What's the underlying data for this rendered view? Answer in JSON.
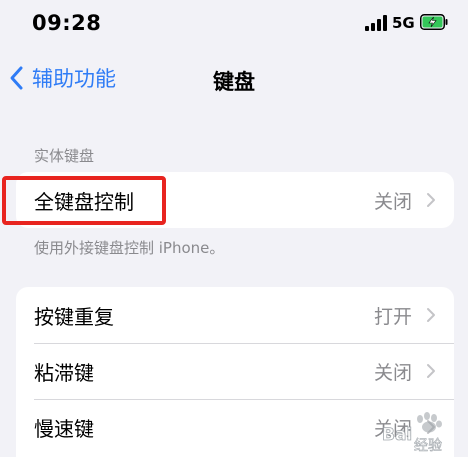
{
  "status_bar": {
    "time": "09:28",
    "network": "5G",
    "battery_color": "#34c759"
  },
  "nav": {
    "back_label": "辅助功能",
    "title": "键盘",
    "accent": "#2f7cf6"
  },
  "physical_keyboard": {
    "header": "实体键盘",
    "items": [
      {
        "label": "全键盘控制",
        "value": "关闭"
      }
    ],
    "footer": "使用外接键盘控制 iPhone。"
  },
  "key_settings": {
    "items": [
      {
        "label": "按键重复",
        "value": "打开"
      },
      {
        "label": "粘滞键",
        "value": "关闭"
      },
      {
        "label": "慢速键",
        "value": "关闭"
      }
    ]
  },
  "annotation": {
    "color": "#e8241f"
  },
  "watermark": {
    "text": "Baidu经验"
  }
}
